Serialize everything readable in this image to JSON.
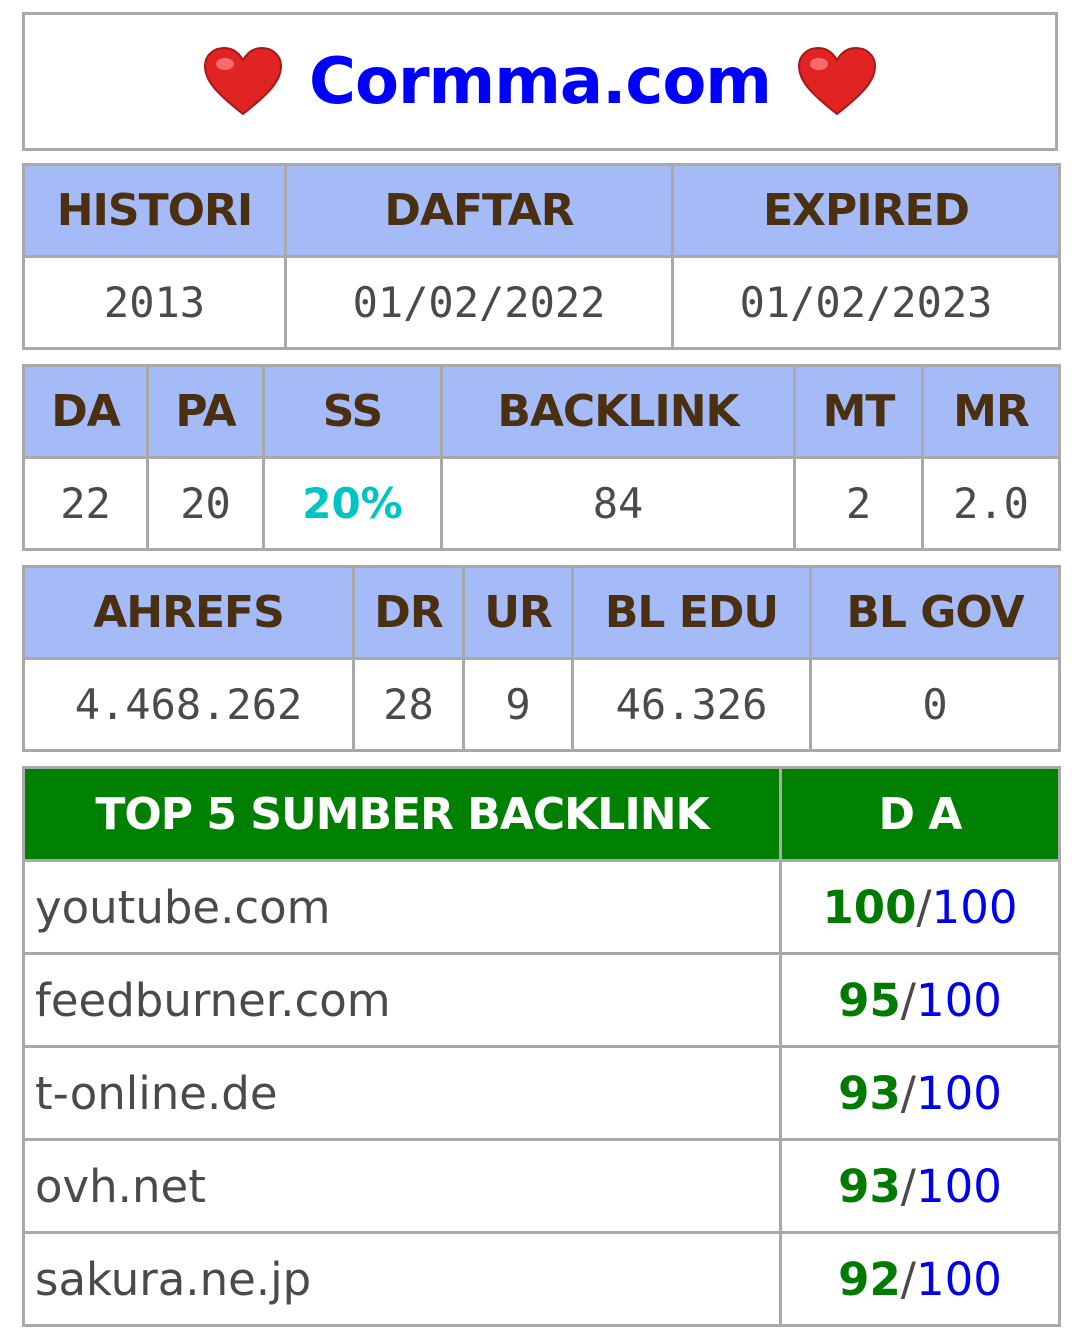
{
  "title": {
    "site": "Cormma.com",
    "site_color": "#0000ff",
    "heart_color": "#e02424",
    "left_icon": "heart-icon",
    "right_icon": "heart-icon"
  },
  "registration": {
    "headers": [
      "HISTORI",
      "DAFTAR",
      "EXPIRED"
    ],
    "values": [
      "2013",
      "01/02/2022",
      "01/02/2023"
    ]
  },
  "moz": {
    "headers": [
      "DA",
      "PA",
      "SS",
      "BACKLINK",
      "MT",
      "MR"
    ],
    "values": [
      "22",
      "20",
      "20%",
      "84",
      "2",
      "2.0"
    ],
    "ss_color": "#00c4c4"
  },
  "ahrefs": {
    "headers": [
      "AHREFS",
      "DR",
      "UR",
      "BL EDU",
      "BL GOV"
    ],
    "values": [
      "4.468.262",
      "28",
      "9",
      "46.326",
      "0"
    ]
  },
  "backlinks": {
    "header": "TOP 5 SUMBER BACKLINK",
    "da_header": "D A",
    "header_bg": "#008000",
    "score_color": "#007a00",
    "max_color": "#0000ee",
    "rows": [
      {
        "domain": "youtube.com",
        "score": "100",
        "sep": "/",
        "max": "100"
      },
      {
        "domain": "feedburner.com",
        "score": "95",
        "sep": "/",
        "max": "100"
      },
      {
        "domain": "t-online.de",
        "score": "93",
        "sep": "/",
        "max": "100"
      },
      {
        "domain": "ovh.net",
        "score": "93",
        "sep": "/",
        "max": "100"
      },
      {
        "domain": "sakura.ne.jp",
        "score": "92",
        "sep": "/",
        "max": "100"
      }
    ]
  },
  "colors": {
    "header_bg": "#a4bbf8",
    "header_text": "#4a2f10",
    "value_text": "#4a4a4a",
    "border": "#a9a9a9"
  }
}
